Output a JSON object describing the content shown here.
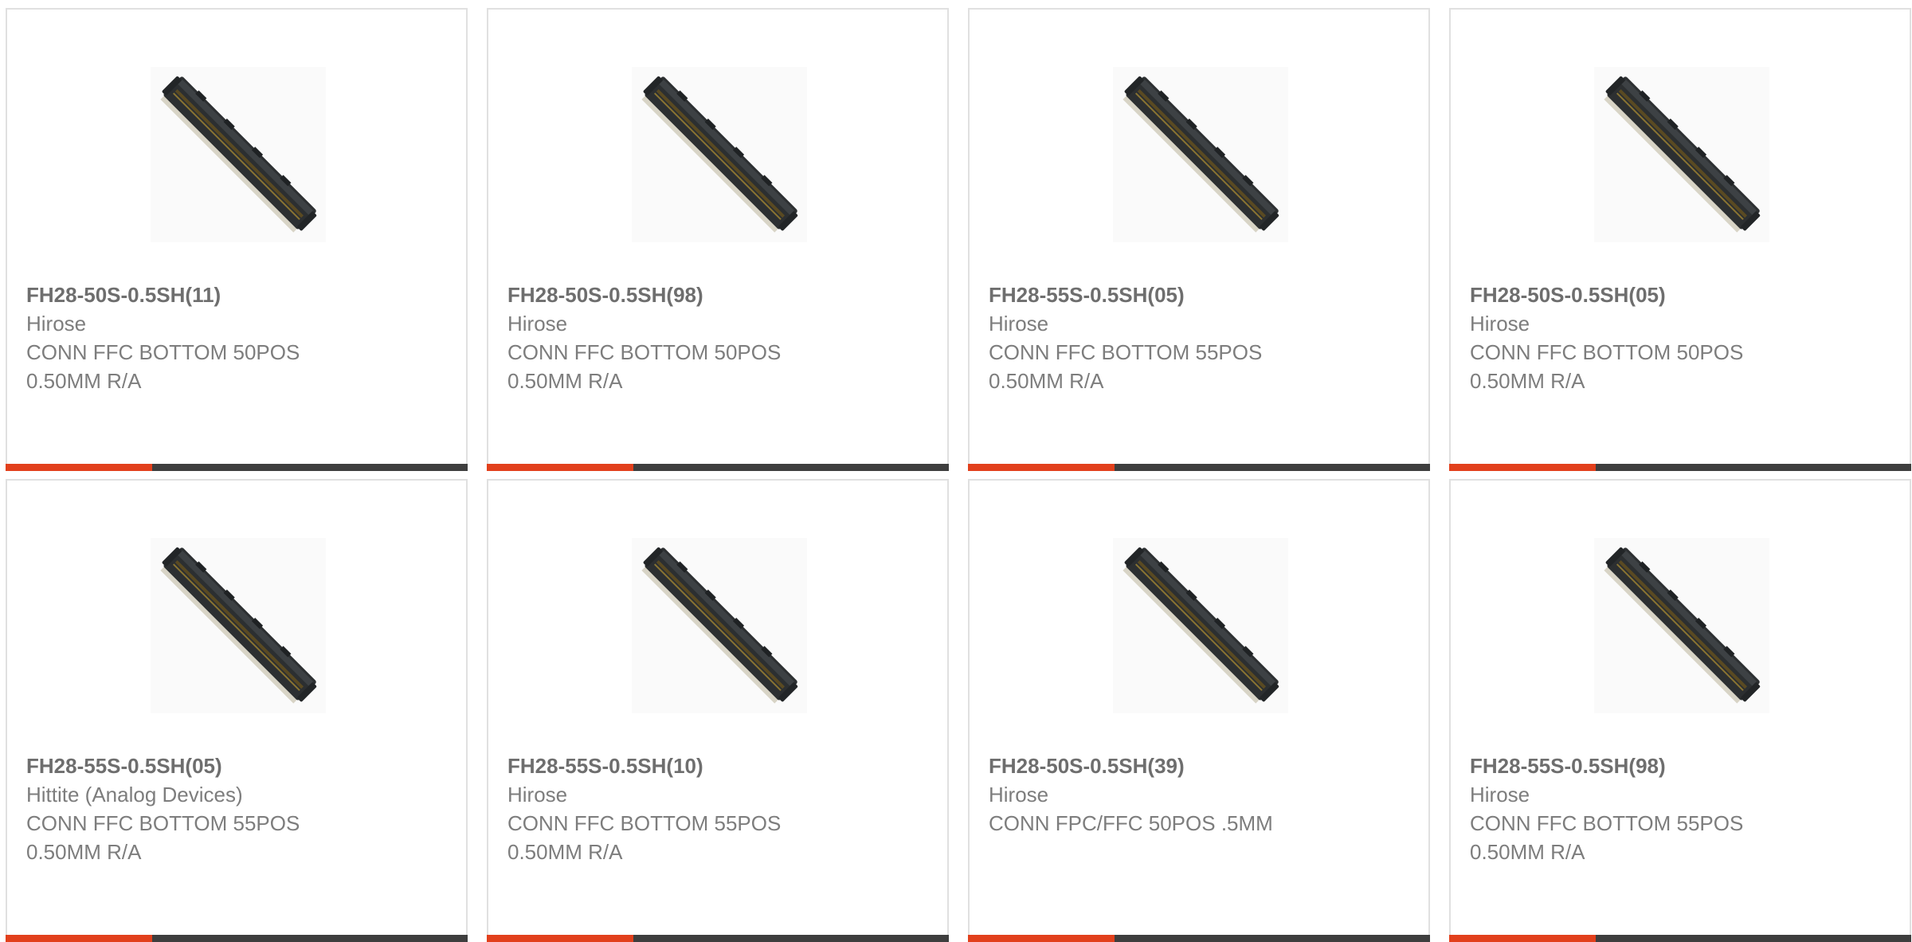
{
  "colors": {
    "accent": "#e2401c",
    "bar": "#3e3e3e",
    "border": "#e0e0e0",
    "text": "#7d7d7d"
  },
  "products": [
    {
      "part_number": "FH28-50S-0.5SH(11)",
      "manufacturer": "Hirose",
      "description": "CONN FFC BOTTOM 50POS 0.50MM R/A",
      "image_icon": "ffc-connector-image"
    },
    {
      "part_number": "FH28-50S-0.5SH(98)",
      "manufacturer": "Hirose",
      "description": "CONN FFC BOTTOM 50POS 0.50MM R/A",
      "image_icon": "ffc-connector-image"
    },
    {
      "part_number": "FH28-55S-0.5SH(05)",
      "manufacturer": "Hirose",
      "description": "CONN FFC BOTTOM 55POS 0.50MM R/A",
      "image_icon": "ffc-connector-image"
    },
    {
      "part_number": "FH28-50S-0.5SH(05)",
      "manufacturer": "Hirose",
      "description": "CONN FFC BOTTOM 50POS 0.50MM R/A",
      "image_icon": "ffc-connector-image"
    },
    {
      "part_number": "FH28-55S-0.5SH(05)",
      "manufacturer": "Hittite (Analog Devices)",
      "description": "CONN FFC BOTTOM 55POS 0.50MM R/A",
      "image_icon": "ffc-connector-image"
    },
    {
      "part_number": "FH28-55S-0.5SH(10)",
      "manufacturer": "Hirose",
      "description": "CONN FFC BOTTOM 55POS 0.50MM R/A",
      "image_icon": "ffc-connector-image"
    },
    {
      "part_number": "FH28-50S-0.5SH(39)",
      "manufacturer": "Hirose",
      "description": "CONN FPC/FFC 50POS .5MM",
      "image_icon": "ffc-connector-image"
    },
    {
      "part_number": "FH28-55S-0.5SH(98)",
      "manufacturer": "Hirose",
      "description": "CONN FFC BOTTOM 55POS 0.50MM R/A",
      "image_icon": "ffc-connector-image"
    }
  ]
}
